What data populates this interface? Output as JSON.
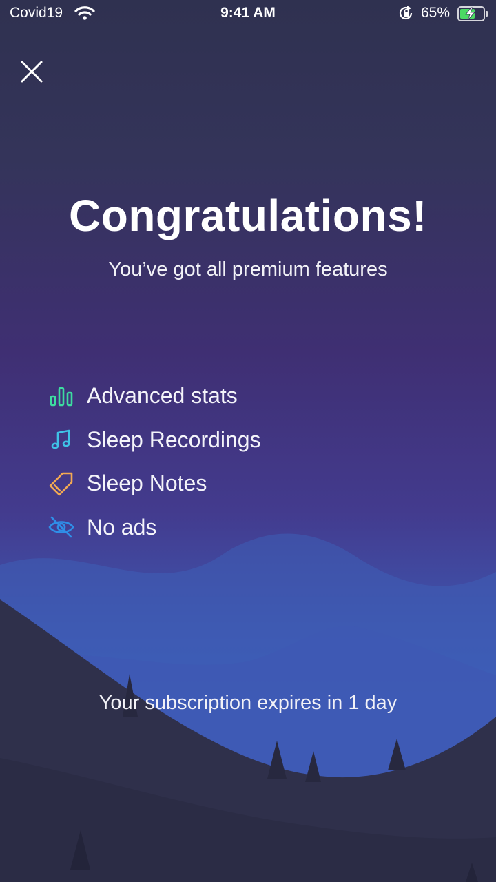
{
  "status_bar": {
    "carrier": "Covid19",
    "time": "9:41 AM",
    "battery": "65%"
  },
  "close_icon": "close-icon",
  "title": "Congratulations!",
  "subtitle": "You’ve got all premium features",
  "features": [
    {
      "label": "Advanced stats",
      "icon": "bar-chart-icon",
      "color": "#3ddca0"
    },
    {
      "label": "Sleep Recordings",
      "icon": "music-note-icon",
      "color": "#3fc2e6"
    },
    {
      "label": "Sleep Notes",
      "icon": "tag-icon",
      "color": "#f2a953"
    },
    {
      "label": "No ads",
      "icon": "eye-off-icon",
      "color": "#2f8fe8"
    }
  ],
  "expiry_text": "Your subscription expires in 1 day",
  "colors": {
    "background_top": "#2f3150",
    "background_mid": "#433b8e",
    "hill_dark": "#2e2f4a",
    "wave_blue": "#3a62bc"
  }
}
